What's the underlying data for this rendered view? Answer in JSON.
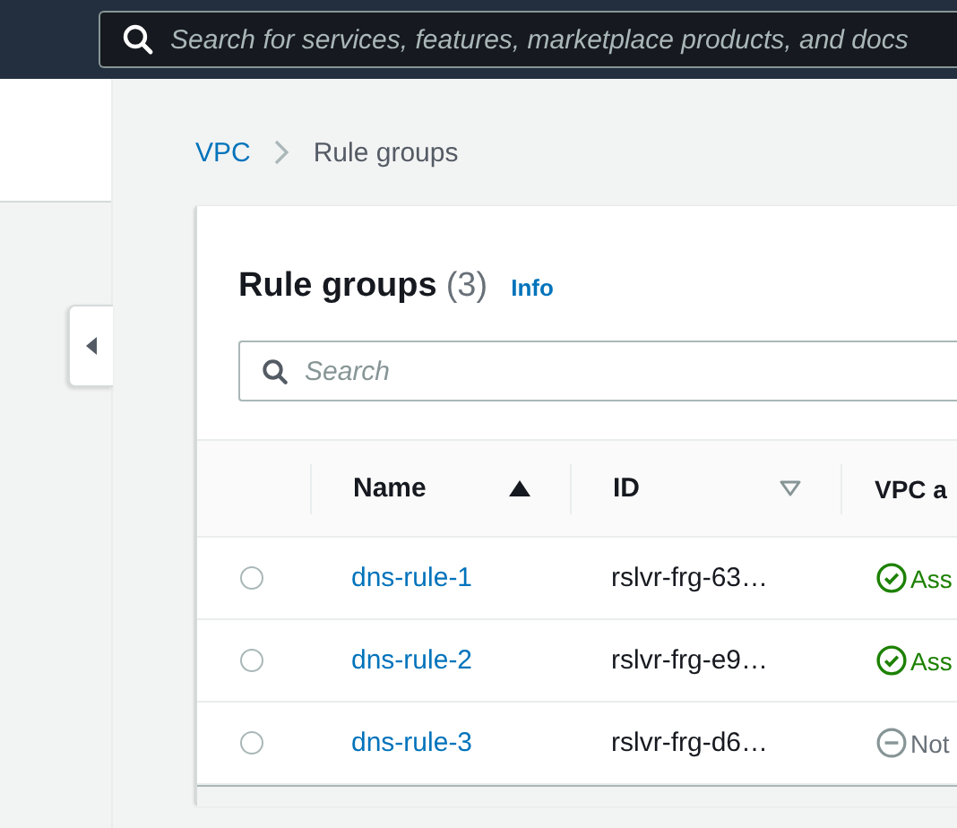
{
  "top_bar": {
    "search": {
      "placeholder": "Search for services, features, marketplace products, and docs"
    }
  },
  "breadcrumbs": [
    {
      "label": "VPC",
      "kind": "link"
    },
    {
      "label": "Rule groups",
      "kind": "current"
    }
  ],
  "panel": {
    "title": "Rule groups",
    "count": "(3)",
    "info": "Info",
    "search": {
      "placeholder": "Search"
    }
  },
  "table": {
    "columns": [
      {
        "label": "Name",
        "sorted": true
      },
      {
        "label": "ID",
        "sorted": false
      },
      {
        "label": "VPC a"
      }
    ],
    "rows": [
      {
        "selected": false,
        "name": "dns-rule-1",
        "id": "rslvr-frg-63…",
        "status": {
          "kind": "success",
          "label": "Ass"
        }
      },
      {
        "selected": false,
        "name": "dns-rule-2",
        "id": "rslvr-frg-e9…",
        "status": {
          "kind": "success",
          "label": "Ass"
        }
      },
      {
        "selected": false,
        "name": "dns-rule-3",
        "id": "rslvr-frg-d6…",
        "status": {
          "kind": "stopped",
          "label": "Not"
        }
      }
    ]
  }
}
